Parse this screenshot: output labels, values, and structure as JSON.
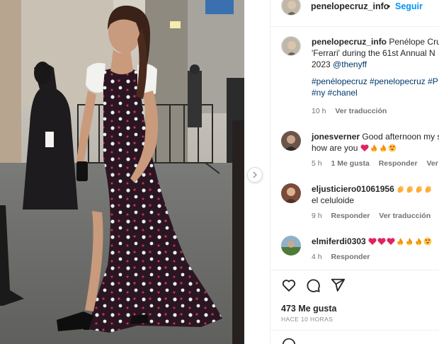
{
  "header": {
    "username": "penelopecruz_info",
    "separator": "•",
    "follow_label": "Seguir"
  },
  "caption": {
    "username": "penelopecruz_info",
    "text_line1": "Penélope Cruz",
    "text_line2": "'Ferrari' during the 61st Annual N",
    "text_line3_prefix": "2023",
    "mention": "@thenyff",
    "hashtags_line1": "#penélopecruz #penelopecruz #P",
    "hashtags_line2": "#ny #chanel",
    "time": "10 h",
    "translate": "Ver traducción"
  },
  "comments": [
    {
      "username": "jonesverner",
      "text_line1": "Good afternoon my s",
      "text_line2": "how are you",
      "emojis": [
        "heart",
        "fire",
        "fire",
        "heart-eyes"
      ],
      "time": "5 h",
      "likes": "1 Me gusta",
      "reply": "Responder",
      "translate": "Ver tra"
    },
    {
      "username": "eljusticiero01061956",
      "emojis": [
        "clap",
        "clap",
        "clap",
        "clap"
      ],
      "text_line2": "el celuloide",
      "time": "9 h",
      "reply": "Responder",
      "translate": "Ver traducción"
    },
    {
      "username": "elmiferdi0303",
      "emojis": [
        "heart",
        "heart",
        "heart",
        "fire",
        "fire",
        "fire",
        "heart-eyes"
      ],
      "time": "4 h",
      "reply": "Responder"
    }
  ],
  "footer": {
    "likes": "473 Me gusta",
    "ago": "HACE 10 HORAS"
  },
  "colors": {
    "link_blue": "#0095f6",
    "mention_blue": "#00376b",
    "meta_gray": "#737373",
    "dress": "#2a1622"
  },
  "icons": [
    "heart-icon",
    "comment-icon",
    "share-icon",
    "chevron-right-icon",
    "emoji-icon"
  ]
}
